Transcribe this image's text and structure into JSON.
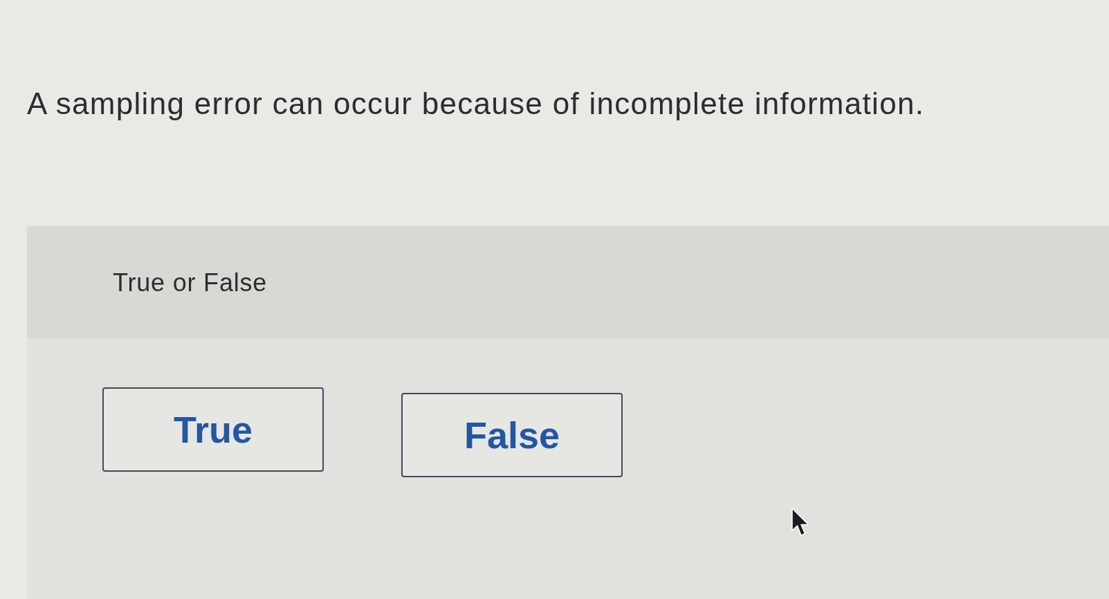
{
  "question": {
    "text": "A sampling error can occur because of incomplete information."
  },
  "answer_panel": {
    "prompt": "True or False",
    "options": [
      {
        "label": "True",
        "selected": false
      },
      {
        "label": "False",
        "selected": false
      }
    ]
  }
}
